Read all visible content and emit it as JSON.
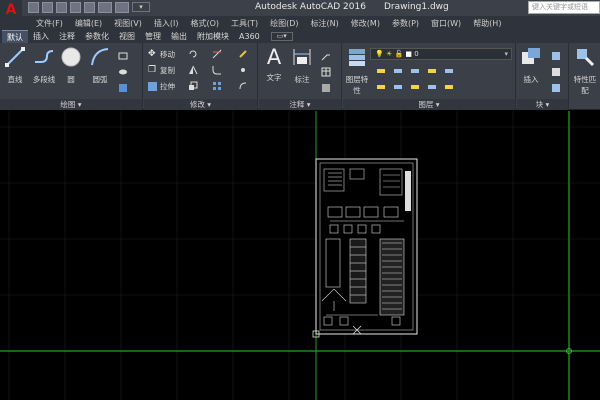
{
  "app": {
    "logo": "A",
    "title_name": "Autodesk AutoCAD 2016",
    "file_name": "Drawing1.dwg",
    "search_placeholder": "键入关键字或短语"
  },
  "quick_access": {
    "icons": [
      "new-icon",
      "open-icon",
      "save-icon",
      "save-as-icon",
      "print-icon",
      "undo-icon",
      "redo-icon"
    ],
    "dropdown_label": "▾"
  },
  "menubar": [
    "文件(F)",
    "编辑(E)",
    "视图(V)",
    "插入(I)",
    "格式(O)",
    "工具(T)",
    "绘图(D)",
    "标注(N)",
    "修改(M)",
    "参数(P)",
    "窗口(W)",
    "帮助(H)"
  ],
  "ribbon_tabs": {
    "items": [
      "默认",
      "插入",
      "注释",
      "参数化",
      "视图",
      "管理",
      "输出",
      "附加模块",
      "A360"
    ],
    "active": "默认"
  },
  "panels": {
    "draw": {
      "title": "绘图 ▾",
      "line": "直线",
      "polyline": "多段线",
      "circle": "圆",
      "arc": "圆弧"
    },
    "modify": {
      "title": "修改 ▾",
      "move": "移动",
      "copy": "复制",
      "stretch": "拉伸"
    },
    "annotation": {
      "title": "注释 ▾",
      "text": "文字",
      "dimension": "标注"
    },
    "layers": {
      "title": "图层 ▾",
      "layer_properties": "图层特性",
      "current_layer": "0"
    },
    "block": {
      "title": "块 ▾",
      "insert": "插入"
    },
    "properties": {
      "match": "特性匹配"
    }
  },
  "colors": {
    "title_bg": "#3c4049",
    "ribbon_bg": "#3a3f48",
    "canvas_bg": "#000000",
    "grid_major": "#1f1f1f",
    "axis_green": "#1a8a1a",
    "logo_red": "#dd1111"
  }
}
